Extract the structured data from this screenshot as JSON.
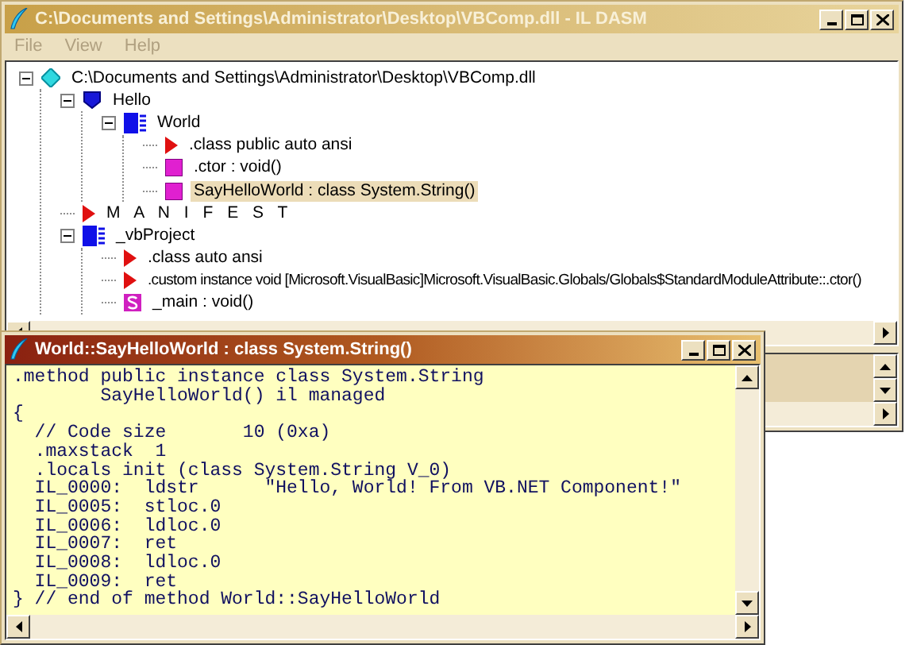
{
  "main_window": {
    "title": "C:\\Documents and Settings\\Administrator\\Desktop\\VBComp.dll - IL DASM",
    "menu": [
      "File",
      "View",
      "Help"
    ],
    "tree": [
      {
        "kind": "assembly",
        "label": "C:\\Documents and Settings\\Administrator\\Desktop\\VBComp.dll",
        "selected": false,
        "expanded": true,
        "children": [
          {
            "kind": "namespace",
            "label": "Hello",
            "selected": false,
            "expanded": true,
            "children": [
              {
                "kind": "class",
                "label": "World",
                "selected": false,
                "expanded": true,
                "children": [
                  {
                    "kind": "info",
                    "label": ".class public auto ansi",
                    "selected": false
                  },
                  {
                    "kind": "method",
                    "label": ".ctor : void()",
                    "selected": false
                  },
                  {
                    "kind": "method",
                    "label": "SayHelloWorld : class System.String()",
                    "selected": true
                  }
                ]
              }
            ]
          },
          {
            "kind": "manifest",
            "label": "M A N I F E S T",
            "selected": false
          },
          {
            "kind": "class",
            "label": "_vbProject",
            "selected": false,
            "expanded": true,
            "children": [
              {
                "kind": "info",
                "label": ".class auto ansi",
                "selected": false
              },
              {
                "kind": "info",
                "label": ".custom instance void [Microsoft.VisualBasic]Microsoft.VisualBasic.Globals/Globals$StandardModuleAttribute::.ctor()",
                "selected": false
              },
              {
                "kind": "static_method",
                "label": "_main : void()",
                "selected": false
              }
            ]
          }
        ]
      }
    ]
  },
  "code_window": {
    "title": "World::SayHelloWorld : class System.String()",
    "lines": [
      ".method public instance class System.String",
      "        SayHelloWorld() il managed",
      "{",
      "  // Code size       10 (0xa)",
      "  .maxstack  1",
      "  .locals init (class System.String V_0)",
      "  IL_0000:  ldstr      \"Hello, World! From VB.NET Component!\"",
      "  IL_0005:  stloc.0",
      "  IL_0006:  ldloc.0",
      "  IL_0007:  ret",
      "  IL_0008:  ldloc.0",
      "  IL_0009:  ret",
      "} // end of method World::SayHelloWorld"
    ]
  }
}
